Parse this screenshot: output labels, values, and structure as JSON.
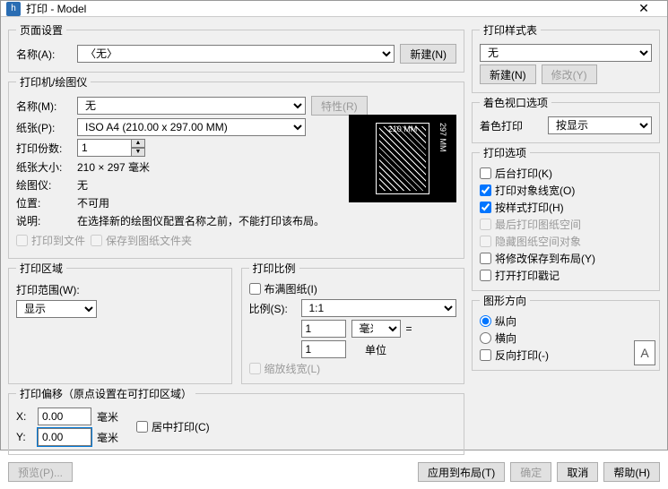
{
  "title": "打印 - Model",
  "page_setup": {
    "legend": "页面设置",
    "name_label": "名称(A):",
    "name_value": "〈无〉",
    "new_btn": "新建(N)"
  },
  "printer": {
    "legend": "打印机/绘图仪",
    "name_label": "名称(M):",
    "name_value": "无",
    "prop_btn": "特性(R)",
    "paper_label": "纸张(P):",
    "paper_value": "ISO A4 (210.00 x 297.00 MM)",
    "copies_label": "打印份数:",
    "copies_value": "1",
    "size_label": "纸张大小:",
    "size_value": "210 × 297  毫米",
    "plotter_label": "绘图仪:",
    "plotter_value": "无",
    "location_label": "位置:",
    "location_value": "不可用",
    "desc_label": "说明:",
    "desc_value": "在选择新的绘图仪配置名称之前，不能打印该布局。",
    "chk_file": "打印到文件",
    "chk_save": "保存到图纸文件夹",
    "preview_top": "210 MM",
    "preview_right": "297 MM"
  },
  "area": {
    "legend": "打印区域",
    "range_label": "打印范围(W):",
    "range_value": "显示"
  },
  "scale": {
    "legend": "打印比例",
    "fit_chk": "布满图纸(I)",
    "ratio_label": "比例(S):",
    "ratio_value": "1:1",
    "num1": "1",
    "unit1": "毫米",
    "eq": "=",
    "num2": "1",
    "unit2": "单位",
    "scale_lw": "缩放线宽(L)"
  },
  "offset": {
    "legend": "打印偏移（原点设置在可打印区域）",
    "x_label": "X:",
    "x_value": "0.00",
    "y_label": "Y:",
    "y_value": "0.00",
    "unit": "毫米",
    "center_chk": "居中打印(C)"
  },
  "style_table": {
    "legend": "打印样式表",
    "value": "无",
    "new_btn": "新建(N)",
    "edit_btn": "修改(Y)"
  },
  "shade": {
    "legend": "着色视口选项",
    "label": "着色打印",
    "value": "按显示"
  },
  "options": {
    "legend": "打印选项",
    "bg": "后台打印(K)",
    "lw": "打印对象线宽(O)",
    "style": "按样式打印(H)",
    "last": "最后打印图纸空间",
    "hide": "隐藏图纸空间对象",
    "save_layout": "将修改保存到布局(Y)",
    "stamp": "打开打印戳记"
  },
  "orient": {
    "legend": "图形方向",
    "portrait": "纵向",
    "landscape": "横向",
    "upside": "反向打印(-)",
    "icon": "A"
  },
  "footer": {
    "preview": "预览(P)...",
    "apply": "应用到布局(T)",
    "ok": "确定",
    "cancel": "取消",
    "help": "帮助(H)"
  }
}
